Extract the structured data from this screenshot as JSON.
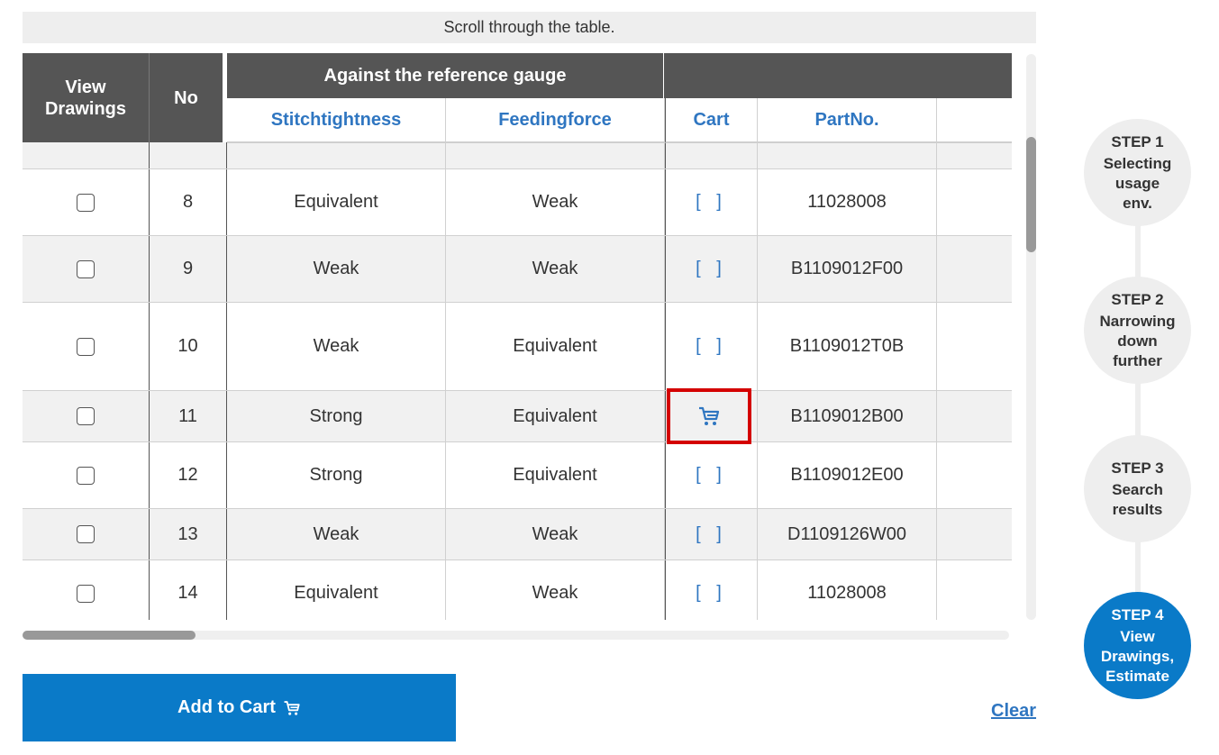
{
  "hint": "Scroll through the table.",
  "header": {
    "view_drawings": "View\nDrawings",
    "no": "No",
    "group_label": "Against the reference gauge",
    "stitchtightness": "Stitchtightness",
    "feedingforce": "Feedingforce",
    "cart": "Cart",
    "partno": "PartNo."
  },
  "rows": [
    {
      "no": "8",
      "stitch": "Equivalent",
      "feeding": "Weak",
      "cart": "[ ]",
      "part": "11028008"
    },
    {
      "no": "9",
      "stitch": "Weak",
      "feeding": "Weak",
      "cart": "[ ]",
      "part": "B1109012F00"
    },
    {
      "no": "10",
      "stitch": "Weak",
      "feeding": "Equivalent",
      "cart": "[ ]",
      "part": "B1109012T0B"
    },
    {
      "no": "11",
      "stitch": "Strong",
      "feeding": "Equivalent",
      "cart": "",
      "part": "B1109012B00"
    },
    {
      "no": "12",
      "stitch": "Strong",
      "feeding": "Equivalent",
      "cart": "[ ]",
      "part": "B1109012E00"
    },
    {
      "no": "13",
      "stitch": "Weak",
      "feeding": "Weak",
      "cart": "[ ]",
      "part": "D1109126W00"
    },
    {
      "no": "14",
      "stitch": "Equivalent",
      "feeding": "Weak",
      "cart": "[ ]",
      "part": "11028008"
    }
  ],
  "add_to_cart": "Add to Cart",
  "clear": "Clear",
  "steps": [
    {
      "num": "STEP 1",
      "label": "Selecting\nusage\nenv."
    },
    {
      "num": "STEP 2",
      "label": "Narrowing\ndown\nfurther"
    },
    {
      "num": "STEP 3",
      "label": "Search\nresults"
    },
    {
      "num": "STEP 4",
      "label": "View\nDrawings,\nEstimate"
    }
  ],
  "colors": {
    "accent": "#0a7ac8",
    "link": "#2f76c1",
    "header": "#555555",
    "highlight": "#d40000"
  }
}
